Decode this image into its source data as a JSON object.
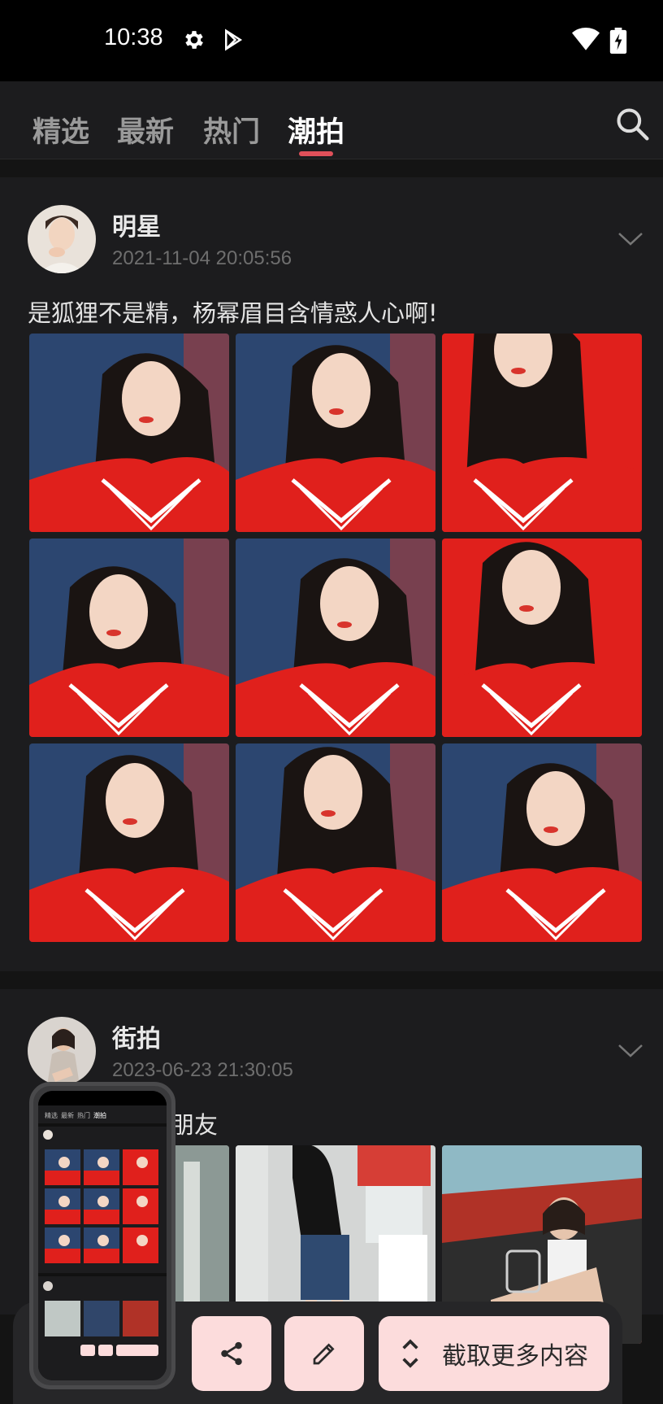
{
  "status_bar": {
    "time": "10:38",
    "icons": [
      "gear-icon",
      "play-store-icon",
      "wifi-icon",
      "battery-charging-icon"
    ]
  },
  "tabs": [
    {
      "label": "精选",
      "active": false
    },
    {
      "label": "最新",
      "active": false
    },
    {
      "label": "热门",
      "active": false
    },
    {
      "label": "潮拍",
      "active": true
    }
  ],
  "search_icon": "search-icon",
  "posts": [
    {
      "author": "明星",
      "time": "2021-11-04 20:05:56",
      "caption": "是狐狸不是精，杨幂眉目含情惑人心啊!",
      "photo_count": 9
    },
    {
      "author": "街拍",
      "time": "2023-06-23 21:30:05",
      "caption": "朋友",
      "photo_count": 3
    }
  ],
  "thumbnail": {
    "tabs": [
      "精选",
      "最新",
      "热门",
      "潮拍"
    ]
  },
  "actions": {
    "share_icon": "share-icon",
    "edit_icon": "pencil-icon",
    "more_icon": "expand-vertical-icon",
    "more_label": "截取更多内容"
  },
  "colors": {
    "accent": "#e0505a",
    "button_bg": "#fcdcdc",
    "card_bg": "#1c1c1e",
    "photo_red": "#e0201c",
    "photo_blue": "#2c4670"
  }
}
